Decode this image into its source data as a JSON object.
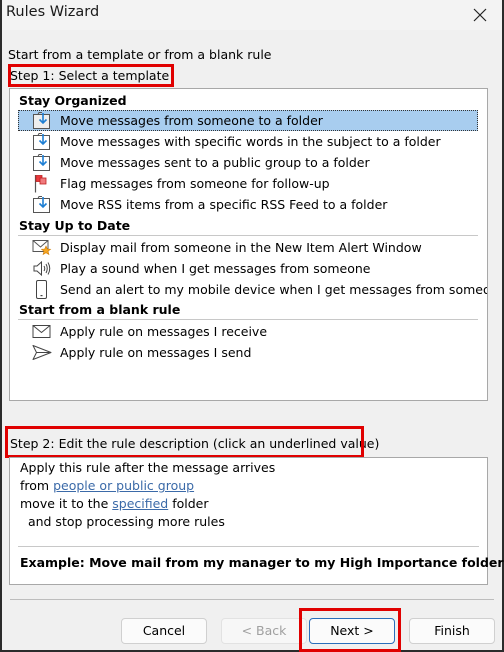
{
  "window": {
    "title": "Rules Wizard",
    "close_icon": "close-icon"
  },
  "intro": "Start from a template or from a blank rule",
  "step1": {
    "label": "Step 1: Select a template",
    "highlighted": true
  },
  "templates": {
    "groups": [
      {
        "title": "Stay Organized",
        "items": [
          {
            "icon": "move-to-folder-icon",
            "label": "Move messages from someone to a folder",
            "selected": true
          },
          {
            "icon": "move-to-folder-icon",
            "label": "Move messages with specific words in the subject to a folder",
            "selected": false
          },
          {
            "icon": "move-to-folder-icon",
            "label": "Move messages sent to a public group to a folder",
            "selected": false
          },
          {
            "icon": "flag-icon",
            "label": "Flag messages from someone for follow-up",
            "selected": false
          },
          {
            "icon": "move-to-folder-icon",
            "label": "Move RSS items from a specific RSS Feed to a folder",
            "selected": false
          }
        ]
      },
      {
        "title": "Stay Up to Date",
        "items": [
          {
            "icon": "mail-star-icon",
            "label": "Display mail from someone in the New Item Alert Window",
            "selected": false
          },
          {
            "icon": "speaker-icon",
            "label": "Play a sound when I get messages from someone",
            "selected": false
          },
          {
            "icon": "mobile-device-icon",
            "label": "Send an alert to my mobile device when I get messages from someone",
            "selected": false
          }
        ]
      },
      {
        "title": "Start from a blank rule",
        "items": [
          {
            "icon": "envelope-icon",
            "label": "Apply rule on messages I receive",
            "selected": false
          },
          {
            "icon": "send-icon",
            "label": "Apply rule on messages I send",
            "selected": false
          }
        ]
      }
    ]
  },
  "step2": {
    "label": "Step 2: Edit the rule description (click an underlined value)",
    "highlighted": true
  },
  "description": {
    "line1": "Apply this rule after the message arrives",
    "line2_prefix": "from ",
    "line2_link": "people or public group",
    "line3_prefix": "move it to the ",
    "line3_link": "specified",
    "line3_suffix": " folder",
    "line4": "  and stop processing more rules",
    "example": "Example: Move mail from my manager to my High Importance folder"
  },
  "buttons": {
    "cancel": "Cancel",
    "back": "< Back",
    "back_enabled": false,
    "next": "Next >",
    "next_highlighted": true,
    "finish": "Finish"
  },
  "colors": {
    "highlight_box": "#e00000",
    "selection": "#a8cdef",
    "link": "#3b6aa8",
    "icon_arrow": "#1e7fd4",
    "flag": "#e8383d"
  }
}
